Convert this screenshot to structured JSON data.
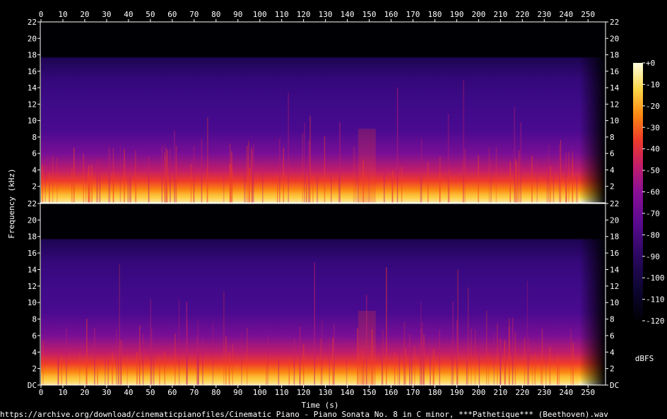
{
  "chart_data": {
    "type": "heatmap",
    "title": "",
    "xlabel": "Time (s)",
    "ylabel": "Frequency (kHz)",
    "x_range": [
      0,
      258
    ],
    "x_ticks": [
      0,
      10,
      20,
      30,
      40,
      50,
      60,
      70,
      80,
      90,
      100,
      110,
      120,
      130,
      140,
      150,
      160,
      170,
      180,
      190,
      200,
      210,
      220,
      230,
      240,
      250
    ],
    "y_range_khz": [
      0,
      22
    ],
    "y_ticks": [
      "DC",
      "2",
      "4",
      "6",
      "8",
      "10",
      "12",
      "14",
      "16",
      "18",
      "20",
      "22"
    ],
    "channels": 2,
    "content_cutoff_khz": 17.8,
    "colorbar": {
      "label": "dBFS",
      "range": [
        -120,
        0
      ],
      "ticks": [
        "+0",
        "-10",
        "-20",
        "-30",
        "-40",
        "-50",
        "-60",
        "-70",
        "-80",
        "-90",
        "-100",
        "-110",
        "-120"
      ]
    },
    "colors": {
      "background": "#000000",
      "scale": [
        "#000004",
        "#0c0630",
        "#2a0860",
        "#5a0a90",
        "#8a0f95",
        "#c01d6a",
        "#ee3a2a",
        "#fb8a12",
        "#fdd84a",
        "#fffee0"
      ]
    }
  },
  "footer": {
    "source_path": "https://archive.org/download/cinematicpianofiles/Cinematic Piano - Piano Sonata No. 8 in C minor, ***Pathetique*** (Beethoven).wav"
  }
}
